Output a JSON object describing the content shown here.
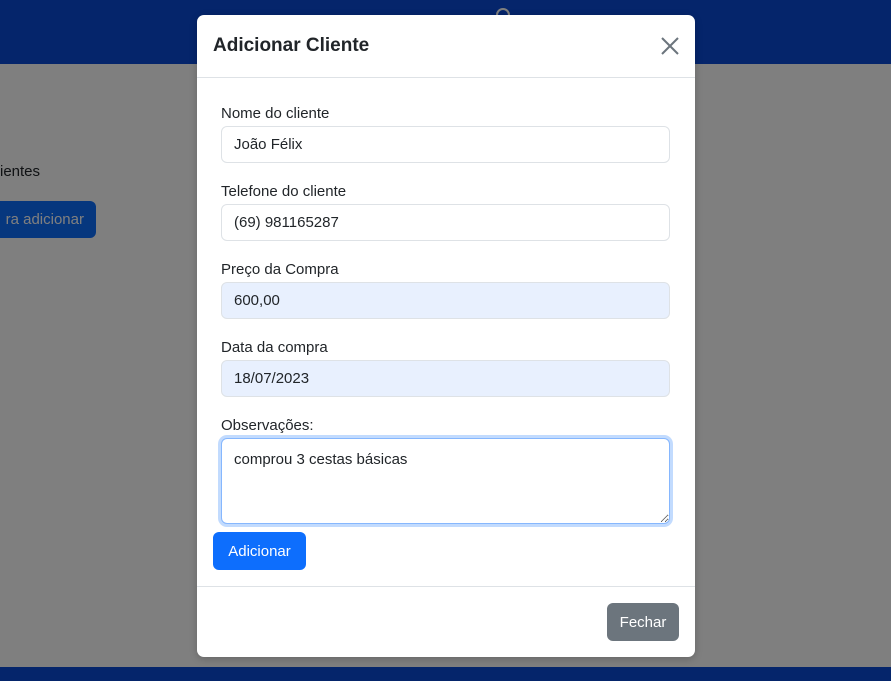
{
  "background": {
    "page_text": "ientes",
    "page_button_label": "ra adicionar"
  },
  "modal": {
    "title": "Adicionar Cliente",
    "fields": [
      {
        "label": "Nome do cliente",
        "value": "João Félix"
      },
      {
        "label": "Telefone do cliente",
        "value": "(69) 981165287"
      },
      {
        "label": "Preço da Compra",
        "value": "600,00"
      },
      {
        "label": "Data da compra",
        "value": "18/07/2023"
      }
    ],
    "notes": {
      "label": "Observações:",
      "value": "comprou 3 cestas básicas"
    },
    "submit_label": "Adicionar",
    "close_label": "Fechar"
  },
  "colors": {
    "navbar": "#0a4bd6",
    "primary": "#0d6efd",
    "secondary": "#6c757d",
    "autofill": "#e8f0fe"
  }
}
